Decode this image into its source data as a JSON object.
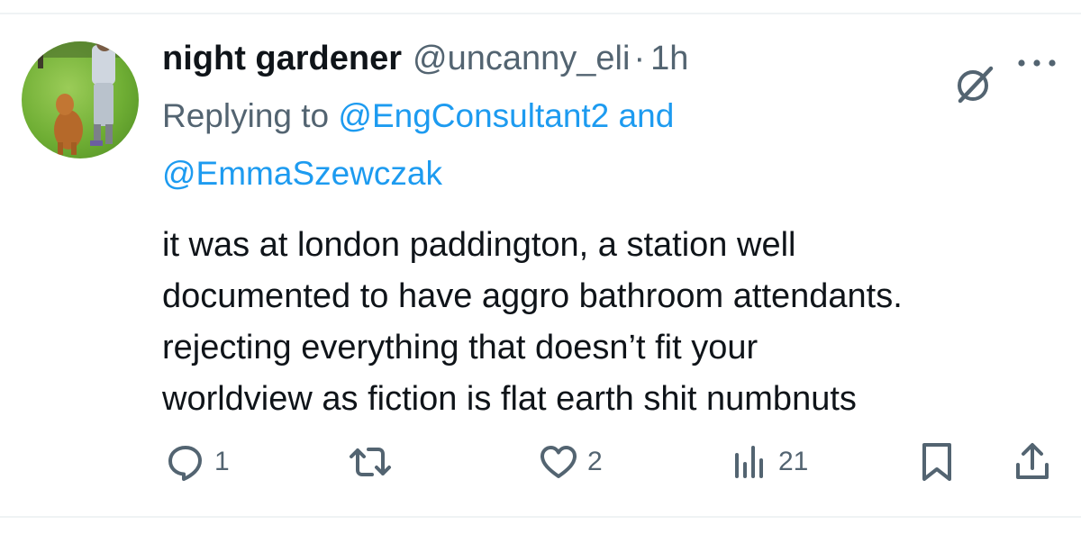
{
  "tweet": {
    "author_name": "night gardener",
    "author_handle": "@uncanny_eli",
    "separator": "·",
    "time": "1h",
    "replying_to_prefix": "Replying to",
    "replying_to_first": "@EngConsultant2",
    "replying_to_joiner": "and",
    "replying_to_second": "@EmmaSzewczak",
    "body_lines": [
      "it was at london paddington, a station well",
      "documented to have aggro bathroom attendants.",
      "rejecting everything that doesn’t fit your",
      "worldview as fiction is flat earth shit numbnuts"
    ]
  },
  "actions": {
    "reply_count": "1",
    "retweet_count": "",
    "like_count": "2",
    "views_count": "21"
  },
  "icons": {
    "avatar": "avatar-photo-person-with-dog",
    "grok": "grok-icon",
    "more": "more-dots-icon",
    "reply": "reply-bubble-icon",
    "retweet": "retweet-icon",
    "like": "heart-icon",
    "views": "views-bar-chart-icon",
    "bookmark": "bookmark-icon",
    "share": "share-icon"
  },
  "colors": {
    "text": "#0f1419",
    "secondary": "#536471",
    "link": "#1d9bf0",
    "divider": "#eff3f4"
  }
}
